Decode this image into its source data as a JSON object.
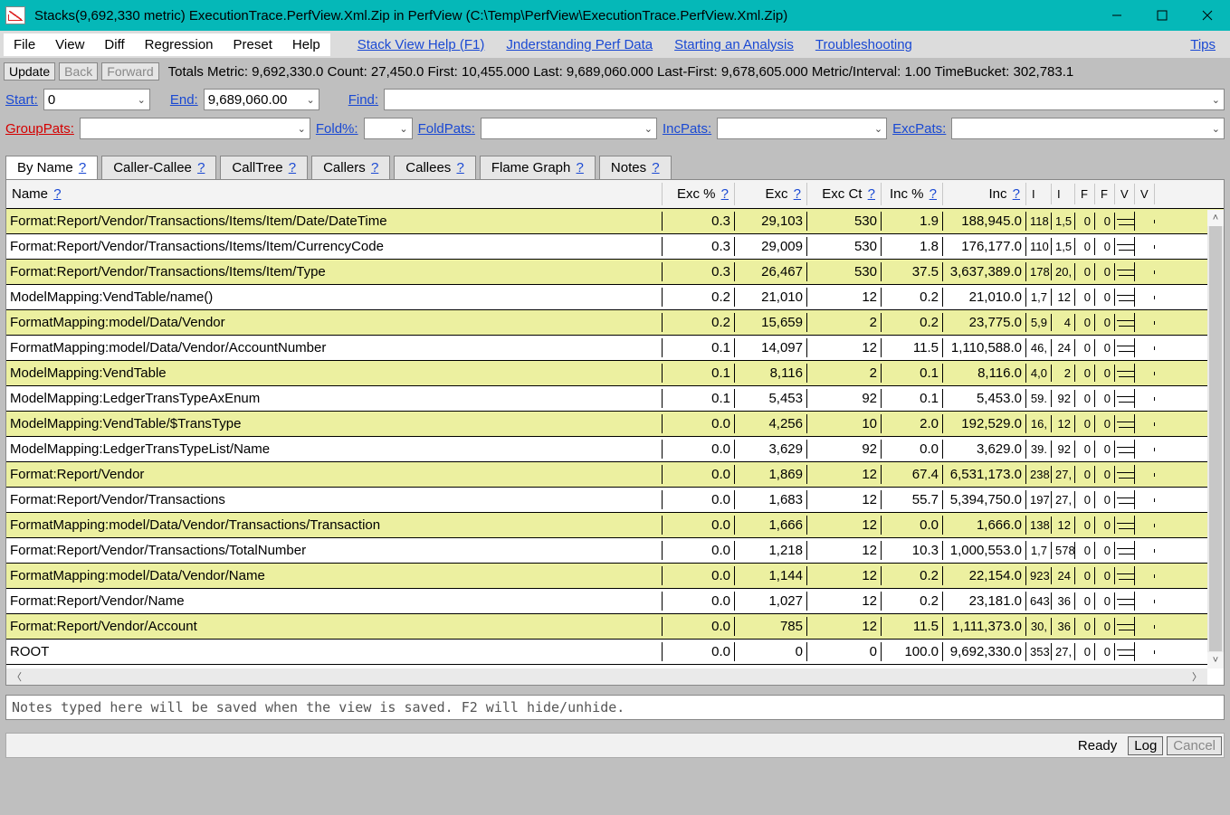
{
  "window": {
    "title": "Stacks(9,692,330 metric) ExecutionTrace.PerfView.Xml.Zip in PerfView (C:\\Temp\\PerfView\\ExecutionTrace.PerfView.Xml.Zip)"
  },
  "menu": {
    "file": "File",
    "view": "View",
    "diff": "Diff",
    "regression": "Regression",
    "preset": "Preset",
    "help": "Help",
    "stackViewHelp": "Stack View Help (F1)",
    "understanding": "Jnderstanding Perf Data",
    "starting": "Starting an Analysis",
    "troubleshooting": "Troubleshooting",
    "tips": "Tips"
  },
  "info": {
    "update": "Update",
    "back": "Back",
    "forward": "Forward",
    "totals": "Totals Metric: 9,692,330.0   Count: 27,450.0   First: 10,455.000  Last: 9,689,060.000   Last-First: 9,678,605.000   Metric/Interval: 1.00   TimeBucket: 302,783.1"
  },
  "filters": {
    "startLabel": "Start:",
    "start": "0",
    "endLabel": "End:",
    "end": "9,689,060.00",
    "findLabel": "Find:",
    "find": "",
    "groupPatsLabel": "GroupPats:",
    "groupPats": "",
    "foldPctLabel": "Fold%:",
    "foldPct": "",
    "foldPatsLabel": "FoldPats:",
    "foldPats": "",
    "incPatsLabel": "IncPats:",
    "incPats": "",
    "excPatsLabel": "ExcPats:",
    "excPats": ""
  },
  "tabs": {
    "byName": "By Name",
    "callerCallee": "Caller-Callee",
    "callTree": "CallTree",
    "callers": "Callers",
    "callees": "Callees",
    "flame": "Flame Graph",
    "notes": "Notes",
    "q": "?"
  },
  "columns": {
    "name": "Name",
    "excp": "Exc %",
    "exc": "Exc",
    "excCt": "Exc Ct",
    "incp": "Inc %",
    "inc": "Inc",
    "s1": "I",
    "s2": "I",
    "s3": "F",
    "s4": "F",
    "s5": "V",
    "s6": "V",
    "q": "?"
  },
  "rows": [
    {
      "name": "Format:Report/Vendor/Transactions/Items/Item/Date/DateTime",
      "excp": "0.3",
      "exc": "29,103",
      "excct": "530",
      "incp": "1.9",
      "inc": "188,945.0",
      "s1": "118",
      "s2": "1,5",
      "s3": "0",
      "s4": "0"
    },
    {
      "name": "Format:Report/Vendor/Transactions/Items/Item/CurrencyCode",
      "excp": "0.3",
      "exc": "29,009",
      "excct": "530",
      "incp": "1.8",
      "inc": "176,177.0",
      "s1": "110",
      "s2": "1,5",
      "s3": "0",
      "s4": "0"
    },
    {
      "name": "Format:Report/Vendor/Transactions/Items/Item/Type",
      "excp": "0.3",
      "exc": "26,467",
      "excct": "530",
      "incp": "37.5",
      "inc": "3,637,389.0",
      "s1": "178",
      "s2": "20,",
      "s3": "0",
      "s4": "0"
    },
    {
      "name": "ModelMapping:VendTable/name()",
      "excp": "0.2",
      "exc": "21,010",
      "excct": "12",
      "incp": "0.2",
      "inc": "21,010.0",
      "s1": "1,7",
      "s2": "12",
      "s3": "0",
      "s4": "0"
    },
    {
      "name": "FormatMapping:model/Data/Vendor",
      "excp": "0.2",
      "exc": "15,659",
      "excct": "2",
      "incp": "0.2",
      "inc": "23,775.0",
      "s1": "5,9",
      "s2": "4",
      "s3": "0",
      "s4": "0"
    },
    {
      "name": "FormatMapping:model/Data/Vendor/AccountNumber",
      "excp": "0.1",
      "exc": "14,097",
      "excct": "12",
      "incp": "11.5",
      "inc": "1,110,588.0",
      "s1": "46,",
      "s2": "24",
      "s3": "0",
      "s4": "0"
    },
    {
      "name": "ModelMapping:VendTable",
      "excp": "0.1",
      "exc": "8,116",
      "excct": "2",
      "incp": "0.1",
      "inc": "8,116.0",
      "s1": "4,0",
      "s2": "2",
      "s3": "0",
      "s4": "0"
    },
    {
      "name": "ModelMapping:LedgerTransTypeAxEnum",
      "excp": "0.1",
      "exc": "5,453",
      "excct": "92",
      "incp": "0.1",
      "inc": "5,453.0",
      "s1": "59.",
      "s2": "92",
      "s3": "0",
      "s4": "0"
    },
    {
      "name": "ModelMapping:VendTable/$TransType",
      "excp": "0.0",
      "exc": "4,256",
      "excct": "10",
      "incp": "2.0",
      "inc": "192,529.0",
      "s1": "16,",
      "s2": "12",
      "s3": "0",
      "s4": "0"
    },
    {
      "name": "ModelMapping:LedgerTransTypeList/Name",
      "excp": "0.0",
      "exc": "3,629",
      "excct": "92",
      "incp": "0.0",
      "inc": "3,629.0",
      "s1": "39.",
      "s2": "92",
      "s3": "0",
      "s4": "0"
    },
    {
      "name": "Format:Report/Vendor",
      "excp": "0.0",
      "exc": "1,869",
      "excct": "12",
      "incp": "67.4",
      "inc": "6,531,173.0",
      "s1": "238",
      "s2": "27,",
      "s3": "0",
      "s4": "0"
    },
    {
      "name": "Format:Report/Vendor/Transactions",
      "excp": "0.0",
      "exc": "1,683",
      "excct": "12",
      "incp": "55.7",
      "inc": "5,394,750.0",
      "s1": "197",
      "s2": "27,",
      "s3": "0",
      "s4": "0"
    },
    {
      "name": "FormatMapping:model/Data/Vendor/Transactions/Transaction",
      "excp": "0.0",
      "exc": "1,666",
      "excct": "12",
      "incp": "0.0",
      "inc": "1,666.0",
      "s1": "138",
      "s2": "12",
      "s3": "0",
      "s4": "0"
    },
    {
      "name": "Format:Report/Vendor/Transactions/TotalNumber",
      "excp": "0.0",
      "exc": "1,218",
      "excct": "12",
      "incp": "10.3",
      "inc": "1,000,553.0",
      "s1": "1,7",
      "s2": "578",
      "s3": "0",
      "s4": "0"
    },
    {
      "name": "FormatMapping:model/Data/Vendor/Name",
      "excp": "0.0",
      "exc": "1,144",
      "excct": "12",
      "incp": "0.2",
      "inc": "22,154.0",
      "s1": "923",
      "s2": "24",
      "s3": "0",
      "s4": "0"
    },
    {
      "name": "Format:Report/Vendor/Name",
      "excp": "0.0",
      "exc": "1,027",
      "excct": "12",
      "incp": "0.2",
      "inc": "23,181.0",
      "s1": "643",
      "s2": "36",
      "s3": "0",
      "s4": "0"
    },
    {
      "name": "Format:Report/Vendor/Account",
      "excp": "0.0",
      "exc": "785",
      "excct": "12",
      "incp": "11.5",
      "inc": "1,111,373.0",
      "s1": "30,",
      "s2": "36",
      "s3": "0",
      "s4": "0"
    },
    {
      "name": "ROOT",
      "excp": "0.0",
      "exc": "0",
      "excct": "0",
      "incp": "100.0",
      "inc": "9,692,330.0",
      "s1": "353",
      "s2": "27,",
      "s3": "0",
      "s4": "0"
    }
  ],
  "notes": {
    "placeholder": "Notes typed here will be saved when the view is saved. F2 will hide/unhide."
  },
  "status": {
    "ready": "Ready",
    "log": "Log",
    "cancel": "Cancel"
  }
}
